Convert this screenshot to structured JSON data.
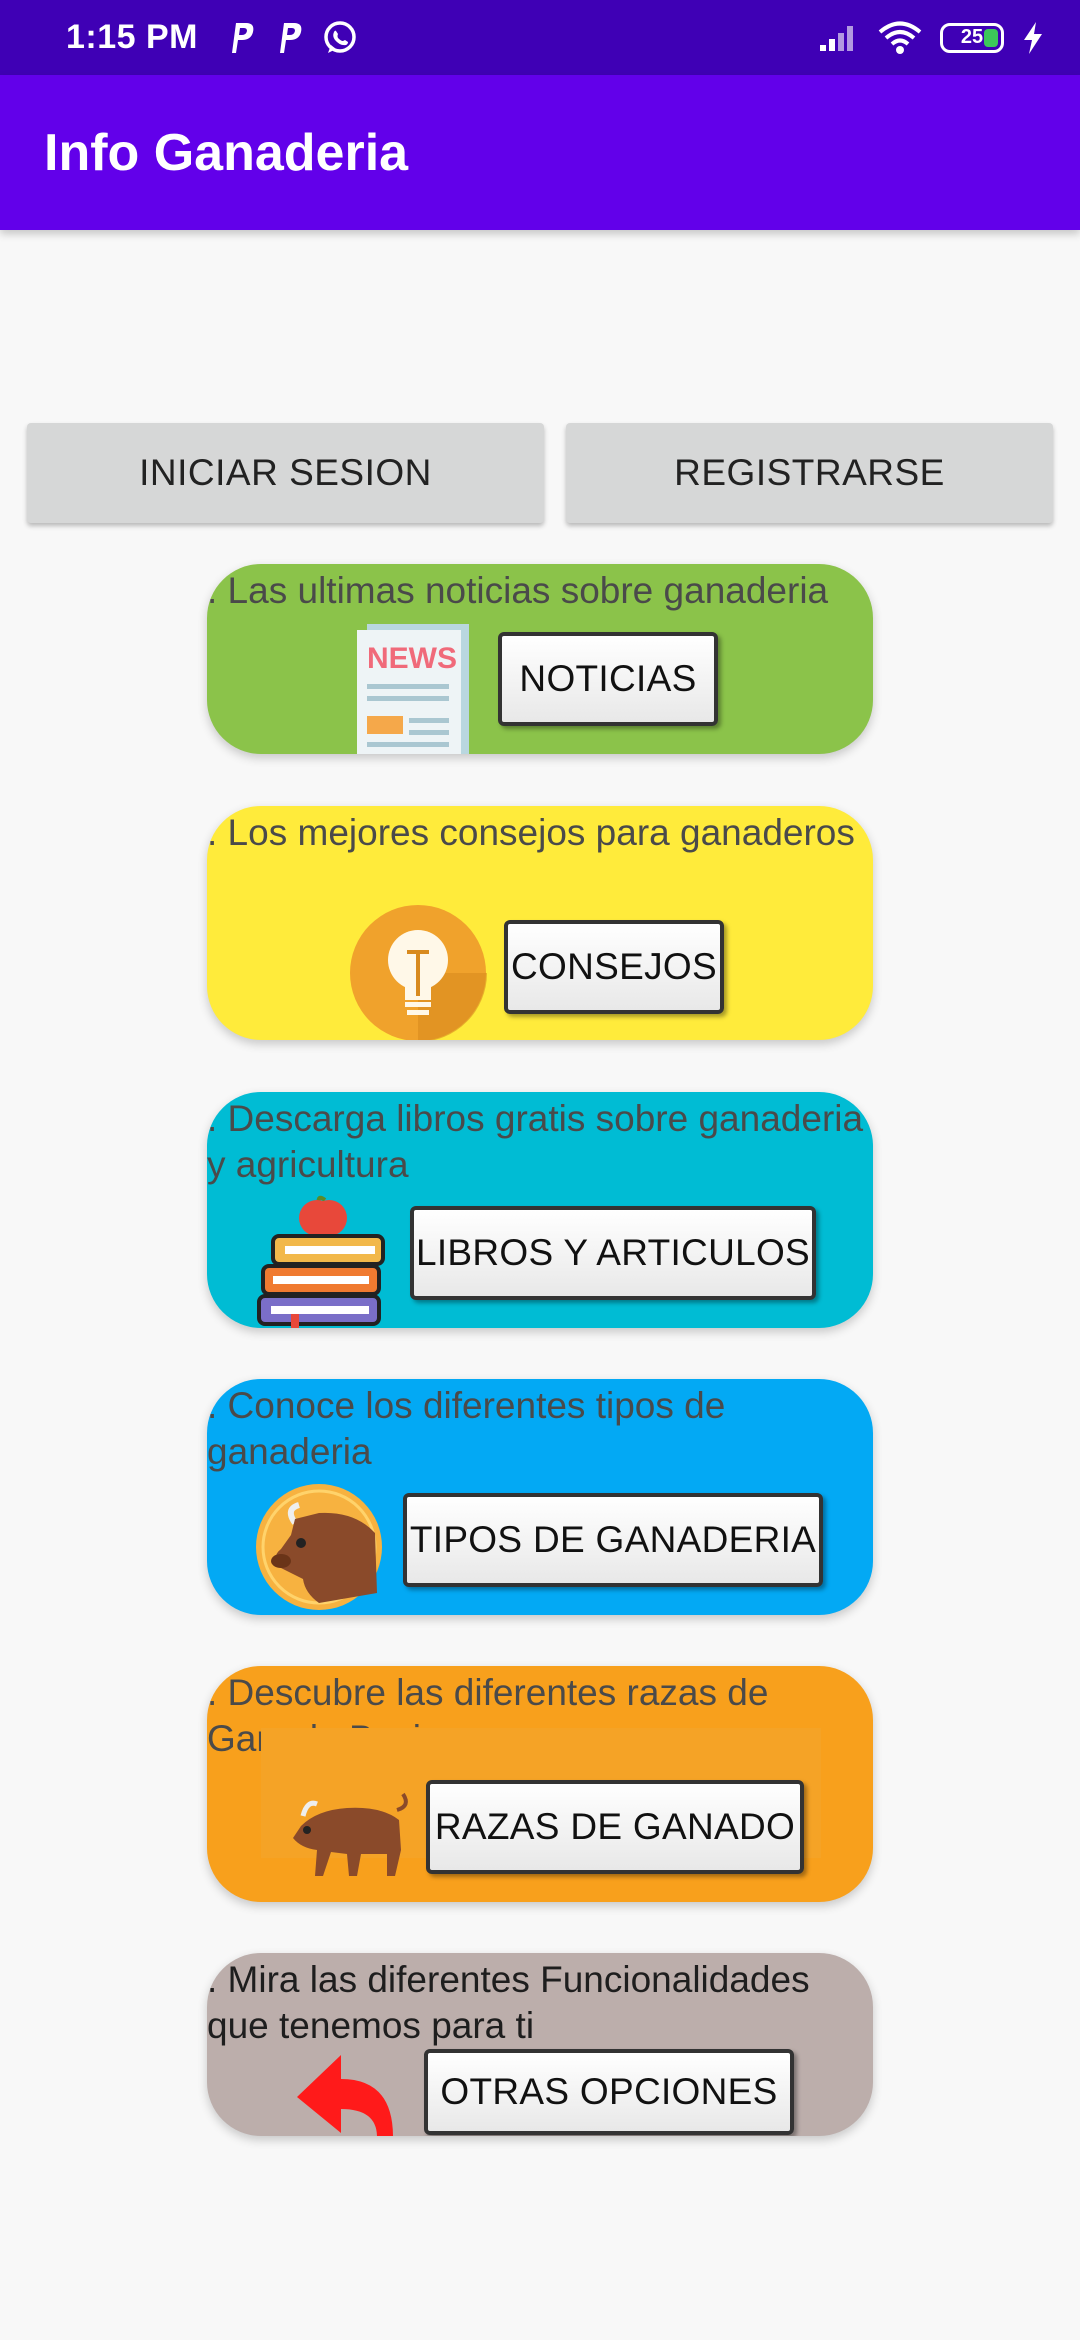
{
  "status_bar": {
    "time": "1:15 PM",
    "battery_level": "25",
    "notification_icons": [
      "p-icon",
      "p-icon",
      "whatsapp-icon"
    ],
    "system_icons": [
      "signal-icon",
      "wifi-icon",
      "battery-icon",
      "charging-icon"
    ]
  },
  "app_bar": {
    "title": "Info Ganaderia"
  },
  "auth": {
    "login_label": "INICIAR SESION",
    "register_label": "REGISTRARSE"
  },
  "cards": [
    {
      "description": ". Las ultimas noticias sobre ganaderia",
      "button": "NOTICIAS",
      "icon": "newspaper-icon",
      "color": "#8bc34a"
    },
    {
      "description": ". Los mejores consejos para ganaderos",
      "button": "CONSEJOS",
      "icon": "lightbulb-icon",
      "color": "#ffeb3b"
    },
    {
      "description": ". Descarga libros gratis sobre ganaderia y agricultura",
      "button": "LIBROS Y ARTICULOS",
      "icon": "books-icon",
      "color": "#00bcd4"
    },
    {
      "description": ". Conoce los diferentes tipos de ganaderia",
      "button": "TIPOS DE GANADERIA",
      "icon": "cow-icon",
      "color": "#03a9f4"
    },
    {
      "description": ". Descubre las diferentes razas de Ganado Bovino",
      "button": "RAZAS DE GANADO",
      "icon": "bull-icon",
      "color": "#f8a01c"
    },
    {
      "description": ". Mira las diferentes Funcionalidades que tenemos para ti",
      "button": "OTRAS OPCIONES",
      "icon": "back-arrow-icon",
      "color": "#bcaeab"
    }
  ]
}
